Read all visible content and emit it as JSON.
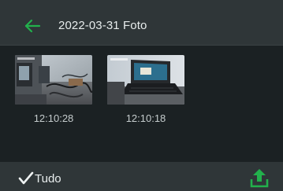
{
  "header": {
    "back_icon": "arrow-left-icon",
    "title": "2022-03-31 Foto"
  },
  "photos": [
    {
      "time": "12:10:28",
      "icon": "photo-thumbnail-desk-clutter"
    },
    {
      "time": "12:10:18",
      "icon": "photo-thumbnail-laptop"
    }
  ],
  "footer": {
    "select_all_label": "Tudo",
    "select_all_checked": true,
    "upload_icon": "upload-icon"
  },
  "colors": {
    "background": "#1b2123",
    "bar": "#2f3638",
    "accent_green": "#22b14c",
    "text": "#e7ecec"
  }
}
